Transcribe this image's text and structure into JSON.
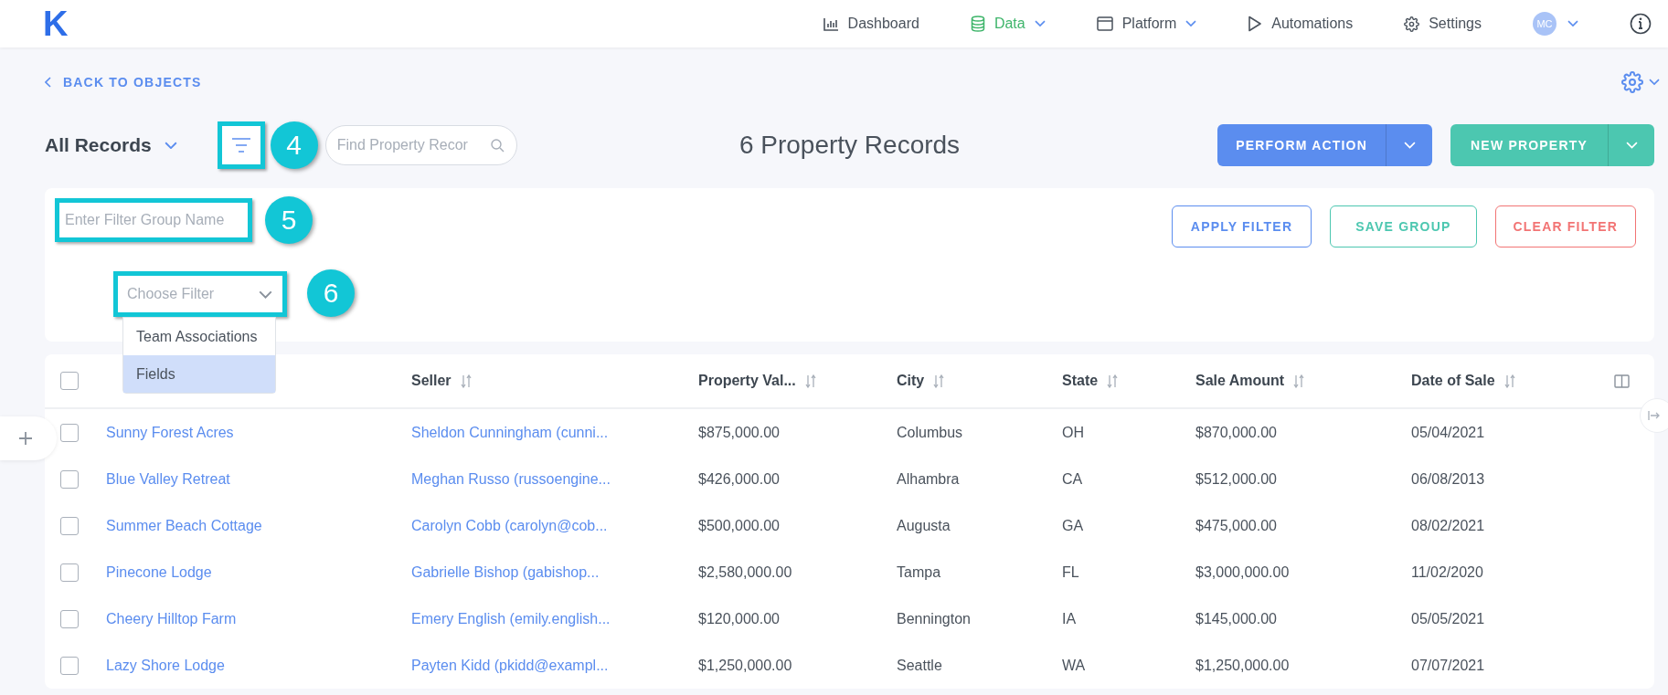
{
  "nav": {
    "logo": "K",
    "items": [
      {
        "label": "Dashboard",
        "selected": false,
        "dropdown": false
      },
      {
        "label": "Data",
        "selected": true,
        "dropdown": true
      },
      {
        "label": "Platform",
        "selected": false,
        "dropdown": true
      },
      {
        "label": "Automations",
        "selected": false,
        "dropdown": false
      },
      {
        "label": "Settings",
        "selected": false,
        "dropdown": false
      }
    ],
    "avatar": "MC"
  },
  "back_link": "BACK TO OBJECTS",
  "toolbar": {
    "view": "All Records",
    "filter_callout": "4",
    "search": {
      "placeholder": "Find Property Recor"
    },
    "title": "6 Property Records",
    "buttons": [
      {
        "label": "PERFORM ACTION",
        "color": "#5b8def"
      },
      {
        "label": "NEW PROPERTY",
        "color": "#4cc7b0"
      }
    ]
  },
  "filter_panel": {
    "group_name": {
      "placeholder": "Enter Filter Group Name",
      "callout": "5"
    },
    "choose_filter": {
      "placeholder": "Choose Filter",
      "callout": "6"
    },
    "menu": [
      {
        "label": "Team Associations",
        "selected": false
      },
      {
        "label": "Fields",
        "selected": true
      }
    ],
    "buttons": [
      {
        "label": "APPLY FILTER",
        "color": "#5b8def"
      },
      {
        "label": "SAVE GROUP",
        "color": "#4cc7b0"
      },
      {
        "label": "CLEAR FILTER",
        "color": "#f27474"
      }
    ]
  },
  "table": {
    "select_all_checked": false,
    "columns": [
      {
        "label": "Seller"
      },
      {
        "label": "Property Val..."
      },
      {
        "label": "City"
      },
      {
        "label": "State"
      },
      {
        "label": "Sale Amount"
      },
      {
        "label": "Date of Sale"
      }
    ],
    "rows": [
      {
        "checked": false,
        "name": "Sunny Forest Acres",
        "seller": "Sheldon Cunningham (cunni...",
        "value": "$875,000.00",
        "city": "Columbus",
        "state": "OH",
        "sale": "$870,000.00",
        "date": "05/04/2021"
      },
      {
        "checked": false,
        "name": "Blue Valley Retreat",
        "seller": "Meghan Russo (russoengine...",
        "value": "$426,000.00",
        "city": "Alhambra",
        "state": "CA",
        "sale": "$512,000.00",
        "date": "06/08/2013"
      },
      {
        "checked": false,
        "name": "Summer Beach Cottage",
        "seller": "Carolyn Cobb (carolyn@cob...",
        "value": "$500,000.00",
        "city": "Augusta",
        "state": "GA",
        "sale": "$475,000.00",
        "date": "08/02/2021"
      },
      {
        "checked": false,
        "name": "Pinecone Lodge",
        "seller": "Gabrielle Bishop (gabishop...",
        "value": "$2,580,000.00",
        "city": "Tampa",
        "state": "FL",
        "sale": "$3,000,000.00",
        "date": "11/02/2020"
      },
      {
        "checked": false,
        "name": "Cheery Hilltop Farm",
        "seller": "Emery English (emily.english...",
        "value": "$120,000.00",
        "city": "Bennington",
        "state": "IA",
        "sale": "$145,000.00",
        "date": "05/05/2021"
      },
      {
        "checked": false,
        "name": "Lazy Shore Lodge",
        "seller": "Payten Kidd (pkidd@exampl...",
        "value": "$1,250,000.00",
        "city": "Seattle",
        "state": "WA",
        "sale": "$1,250,000.00",
        "date": "07/07/2021"
      }
    ]
  }
}
